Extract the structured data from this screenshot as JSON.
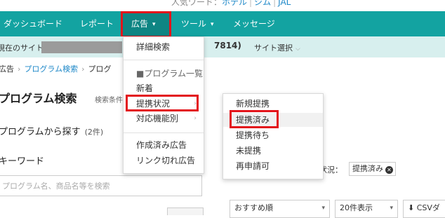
{
  "top": {
    "popular_label": "人気ワード：",
    "links": [
      "ホテル",
      "ジム",
      "JAL"
    ]
  },
  "nav": {
    "items": [
      {
        "label": "ダッシュボード"
      },
      {
        "label": "レポート"
      },
      {
        "label": "広告",
        "caret": "▾",
        "active": true
      },
      {
        "label": "ツール",
        "caret": "▾"
      },
      {
        "label": "メッセージ"
      }
    ]
  },
  "site_bar": {
    "label": "現在のサイト",
    "site_id_suffix": "7814)",
    "select_label": "サイト選択",
    "select_chevron": "⌵"
  },
  "breadcrumb": {
    "items": [
      "広告",
      "プログラム検索",
      "プログ"
    ],
    "arrow": "›"
  },
  "page": {
    "title": "プログラム検索",
    "subtitle": "検索条件",
    "section_label": "プログラムから探す",
    "count": "(2件)",
    "keyword_label": "キーワード",
    "search_placeholder": "プログラム名、商品名等を検索"
  },
  "filter": {
    "label": "状況：",
    "chip": "提携済み",
    "chip_close": "✕"
  },
  "sort": {
    "order": "おすすめ順",
    "per_page": "20件表示",
    "csv": "CSVダ",
    "chevron": "▾",
    "download_icon": "⬇"
  },
  "menu_main": {
    "items": [
      {
        "label": "詳細検索"
      },
      {
        "label": "■プログラム一覧",
        "header": true
      },
      {
        "label": "新着"
      },
      {
        "label": "提携状況",
        "submenu": "›"
      },
      {
        "label": "対応機能別",
        "submenu": "›"
      },
      {
        "label": "作成済み広告"
      },
      {
        "label": "リンク切れ広告"
      }
    ]
  },
  "menu_sub": {
    "items": [
      {
        "label": "新規提携"
      },
      {
        "label": "提携済み",
        "hover": true
      },
      {
        "label": "提携待ち"
      },
      {
        "label": "未提携"
      },
      {
        "label": "再申請可"
      }
    ]
  },
  "colors": {
    "nav_bg": "#13a3a1",
    "nav_active": "#0e8583",
    "highlight": "#e3141b",
    "site_bar": "#d7efee",
    "link": "#1e88c8"
  }
}
